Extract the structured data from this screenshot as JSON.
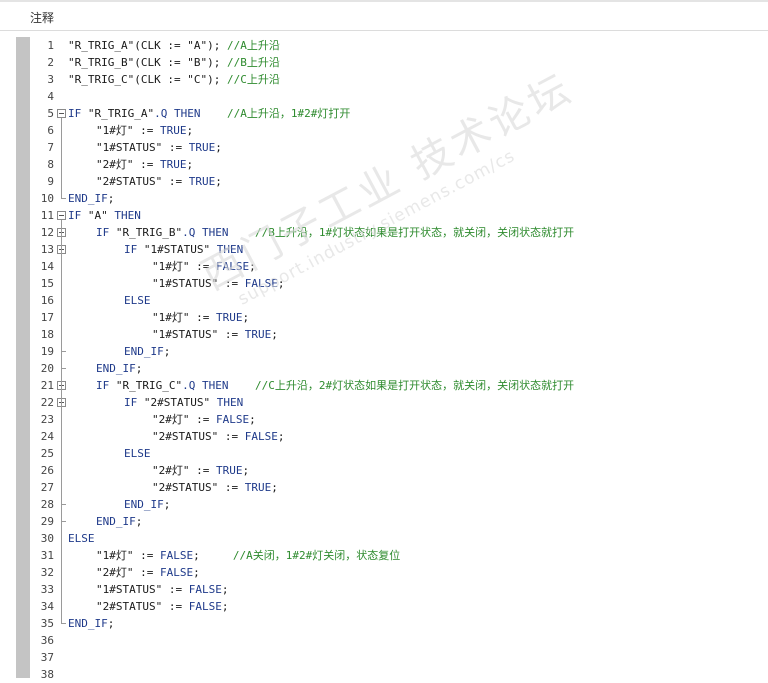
{
  "header": {
    "title": "注释"
  },
  "watermark": {
    "text": "西门子工业 技术论坛",
    "sub": "support.industry.siemens.com/cs"
  },
  "code_lines": [
    {
      "n": "1",
      "indent": 0,
      "text": "\"R_TRIG_A\"(CLK := \"A\"); //A上升沿"
    },
    {
      "n": "2",
      "indent": 0,
      "text": "\"R_TRIG_B\"(CLK := \"B\"); //B上升沿"
    },
    {
      "n": "3",
      "indent": 0,
      "text": "\"R_TRIG_C\"(CLK := \"C\"); //C上升沿"
    },
    {
      "n": "4",
      "indent": 0,
      "text": ""
    },
    {
      "n": "5",
      "indent": 0,
      "text": "IF \"R_TRIG_A\".Q THEN    //A上升沿，1#2#灯打开"
    },
    {
      "n": "6",
      "indent": 1,
      "text": "\"1#灯\" := TRUE;"
    },
    {
      "n": "7",
      "indent": 1,
      "text": "\"1#STATUS\" := TRUE;"
    },
    {
      "n": "8",
      "indent": 1,
      "text": "\"2#灯\" := TRUE;"
    },
    {
      "n": "9",
      "indent": 1,
      "text": "\"2#STATUS\" := TRUE;"
    },
    {
      "n": "10",
      "indent": 0,
      "text": "END_IF;"
    },
    {
      "n": "11",
      "indent": 0,
      "text": "IF \"A\" THEN"
    },
    {
      "n": "12",
      "indent": 1,
      "text": "IF \"R_TRIG_B\".Q THEN    //B上升沿，1#灯状态如果是打开状态，就关闭，关闭状态就打开"
    },
    {
      "n": "13",
      "indent": 2,
      "text": "IF \"1#STATUS\" THEN"
    },
    {
      "n": "14",
      "indent": 3,
      "text": "\"1#灯\" := FALSE;"
    },
    {
      "n": "15",
      "indent": 3,
      "text": "\"1#STATUS\" := FALSE;"
    },
    {
      "n": "16",
      "indent": 2,
      "text": "ELSE"
    },
    {
      "n": "17",
      "indent": 3,
      "text": "\"1#灯\" := TRUE;"
    },
    {
      "n": "18",
      "indent": 3,
      "text": "\"1#STATUS\" := TRUE;"
    },
    {
      "n": "19",
      "indent": 2,
      "text": "END_IF;"
    },
    {
      "n": "20",
      "indent": 1,
      "text": "END_IF;"
    },
    {
      "n": "21",
      "indent": 1,
      "text": "IF \"R_TRIG_C\".Q THEN    //C上升沿，2#灯状态如果是打开状态，就关闭，关闭状态就打开"
    },
    {
      "n": "22",
      "indent": 2,
      "text": "IF \"2#STATUS\" THEN"
    },
    {
      "n": "23",
      "indent": 3,
      "text": "\"2#灯\" := FALSE;"
    },
    {
      "n": "24",
      "indent": 3,
      "text": "\"2#STATUS\" := FALSE;"
    },
    {
      "n": "25",
      "indent": 2,
      "text": "ELSE"
    },
    {
      "n": "26",
      "indent": 3,
      "text": "\"2#灯\" := TRUE;"
    },
    {
      "n": "27",
      "indent": 3,
      "text": "\"2#STATUS\" := TRUE;"
    },
    {
      "n": "28",
      "indent": 2,
      "text": "END_IF;"
    },
    {
      "n": "29",
      "indent": 1,
      "text": "END_IF;"
    },
    {
      "n": "30",
      "indent": 0,
      "text": "ELSE"
    },
    {
      "n": "31",
      "indent": 1,
      "text": "\"1#灯\" := FALSE;     //A关闭，1#2#灯关闭，状态复位"
    },
    {
      "n": "32",
      "indent": 1,
      "text": "\"2#灯\" := FALSE;"
    },
    {
      "n": "33",
      "indent": 1,
      "text": "\"1#STATUS\" := FALSE;"
    },
    {
      "n": "34",
      "indent": 1,
      "text": "\"2#STATUS\" := FALSE;"
    },
    {
      "n": "35",
      "indent": 0,
      "text": "END_IF;"
    },
    {
      "n": "36",
      "indent": 0,
      "text": ""
    },
    {
      "n": "37",
      "indent": 0,
      "text": ""
    },
    {
      "n": "38",
      "indent": 0,
      "text": ""
    }
  ],
  "fold_markers": [
    "5",
    "11",
    "12",
    "13",
    "21",
    "22"
  ],
  "colors": {
    "keyword": "#1f3a8a",
    "string": "#1a1a1a",
    "comment": "#2e8b2e",
    "line_number": "#444444",
    "gutter": "#c4c4c4"
  }
}
